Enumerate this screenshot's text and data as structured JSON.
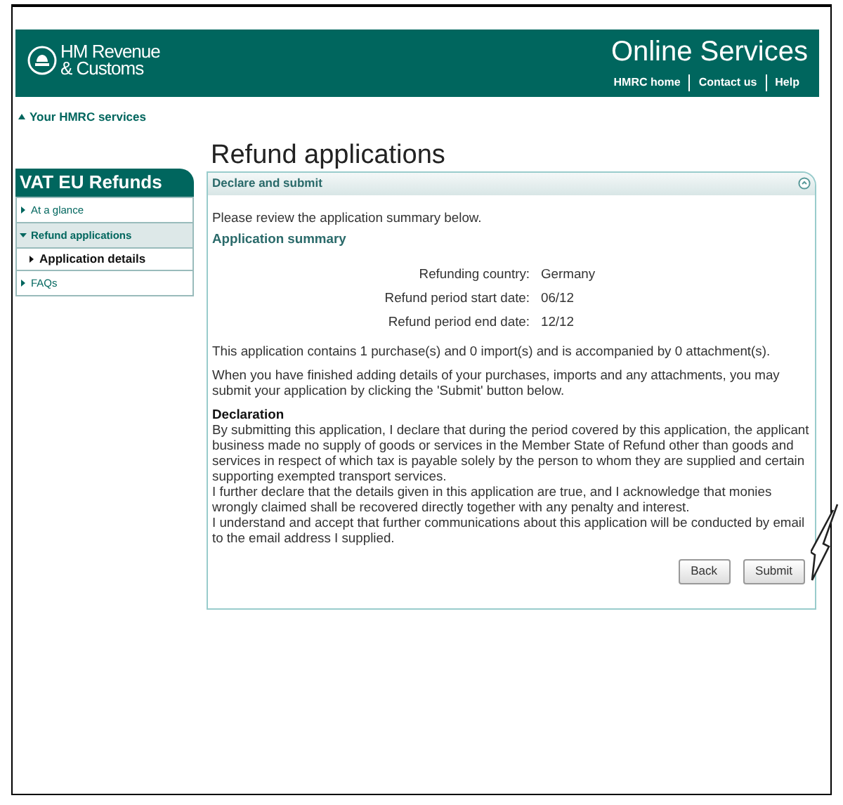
{
  "header": {
    "logo_text": [
      "HM Revenue",
      "& Customs"
    ],
    "title": "Online Services",
    "links": [
      "HMRC home",
      "Contact us",
      "Help"
    ]
  },
  "back_link": "Your HMRC services",
  "sidebar": {
    "title": "VAT EU Refunds",
    "items": [
      {
        "label": "At a glance",
        "selected": false,
        "expanded": false
      },
      {
        "label": "Refund applications",
        "selected": true,
        "expanded": true,
        "children": [
          {
            "label": "Application details",
            "selected": false,
            "expanded": false
          }
        ]
      },
      {
        "label": "FAQs",
        "selected": false,
        "expanded": false
      }
    ]
  },
  "page_title": "Refund applications",
  "panel": {
    "title": "Declare and submit",
    "intro": "Please review the application summary below.",
    "summary_heading": "Application summary",
    "summary": [
      {
        "label": "Refunding country:",
        "value": "Germany"
      },
      {
        "label": "Refund period start date:",
        "value": "06/12"
      },
      {
        "label": "Refund period end date:",
        "value": "12/12"
      }
    ],
    "contents_text": "This application contains 1 purchase(s) and 0 import(s) and is accompanied by 0 attachment(s).",
    "instructions": "When you have finished adding details of your purchases, imports and any attachments, you may submit your application by clicking the 'Submit' button below.",
    "declaration_heading": "Declaration",
    "declaration": [
      "By submitting this application, I declare that during the period covered by this application, the applicant business made no supply of goods or services in the Member State of Refund other than goods and services in respect of which tax is payable solely by the person to whom they are supplied and certain supporting exempted transport services.",
      "I further declare that the details given in this application are true, and I acknowledge that monies wrongly claimed shall be recovered directly together with any penalty and interest.",
      "I understand and accept that further communications about this application will be conducted by email to the email address I supplied."
    ],
    "buttons": [
      "Back",
      "Submit"
    ]
  }
}
